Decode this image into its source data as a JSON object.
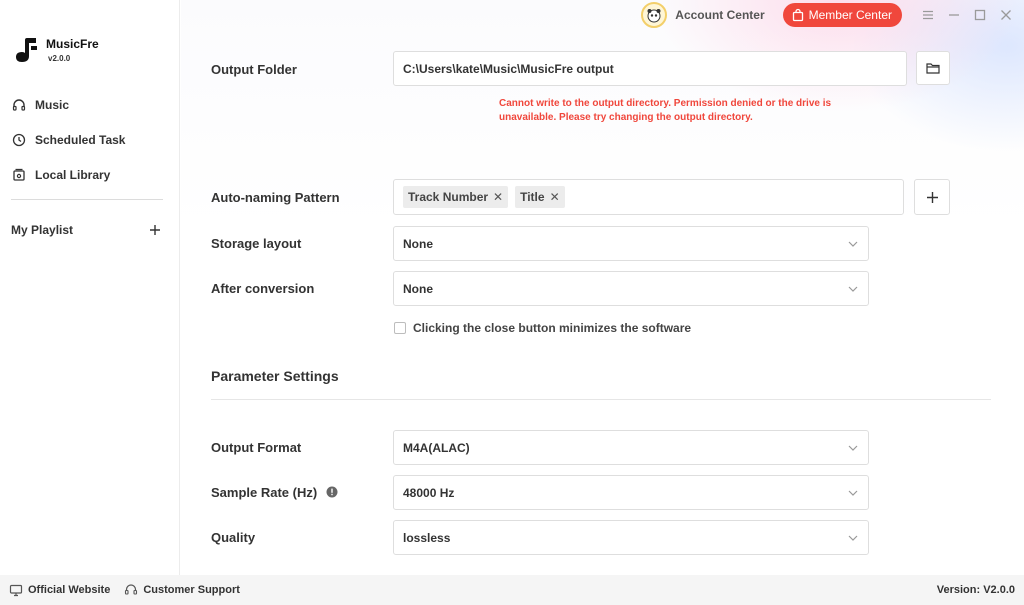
{
  "app": {
    "name": "MusicFre",
    "version": "v2.0.0"
  },
  "sidebar": {
    "items": [
      {
        "label": "Music",
        "icon": "headphones-icon"
      },
      {
        "label": "Scheduled Task",
        "icon": "clock-icon"
      },
      {
        "label": "Local Library",
        "icon": "library-icon"
      }
    ],
    "playlist_label": "My Playlist"
  },
  "header": {
    "account_label": "Account Center",
    "member_label": "Member Center"
  },
  "settings": {
    "output_folder": {
      "label": "Output Folder",
      "value": "C:\\Users\\kate\\Music\\MusicFre output",
      "error": "Cannot write to the output directory. Permission denied or the drive is unavailable. Please try changing the output directory."
    },
    "auto_naming": {
      "label": "Auto-naming Pattern",
      "tags": [
        "Track Number",
        "Title"
      ]
    },
    "storage_layout": {
      "label": "Storage layout",
      "value": "None"
    },
    "after_conversion": {
      "label": "After conversion",
      "value": "None"
    },
    "minimize_checkbox": {
      "label": "Clicking the close button minimizes the software",
      "checked": false
    },
    "parameter_title": "Parameter Settings",
    "output_format": {
      "label": "Output Format",
      "value": "M4A(ALAC)"
    },
    "sample_rate": {
      "label": "Sample Rate (Hz)",
      "value": "48000 Hz"
    },
    "quality": {
      "label": "Quality",
      "value": "lossless"
    }
  },
  "footer": {
    "website_label": "Official Website",
    "support_label": "Customer Support",
    "version_label": "Version: V2.0.0"
  },
  "colors": {
    "accent": "#f0473c",
    "error": "#f0473c"
  }
}
